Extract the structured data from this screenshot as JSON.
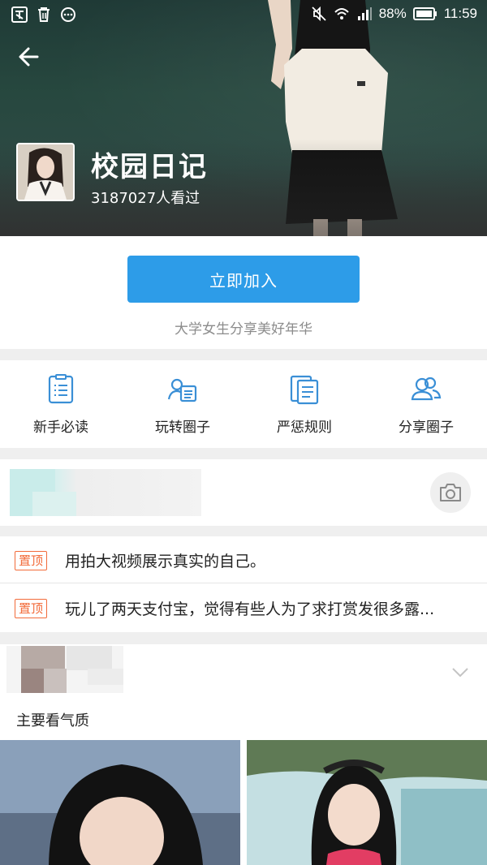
{
  "status_bar": {
    "battery": "88%",
    "time": "11:59"
  },
  "header": {
    "title": "校园日记",
    "views": "3187027人看过"
  },
  "join": {
    "button_label": "立即加入",
    "description": "大学女生分享美好年华"
  },
  "menu": {
    "items": [
      {
        "label": "新手必读",
        "icon": "document-list-icon"
      },
      {
        "label": "玩转圈子",
        "icon": "person-card-icon"
      },
      {
        "label": "严惩规则",
        "icon": "rules-document-icon"
      },
      {
        "label": "分享圈子",
        "icon": "users-icon"
      }
    ]
  },
  "pinned": {
    "tag": "置顶",
    "items": [
      {
        "text": "用拍大视频展示真实的自己。"
      },
      {
        "text": "玩儿了两天支付宝，觉得有些人为了求打赏发很多露..."
      }
    ]
  },
  "feed": {
    "caption": "主要看气质"
  },
  "colors": {
    "accent": "#2d9ce8",
    "pin_tag": "#f26b3a",
    "icon_blue": "#3a8fd6"
  }
}
